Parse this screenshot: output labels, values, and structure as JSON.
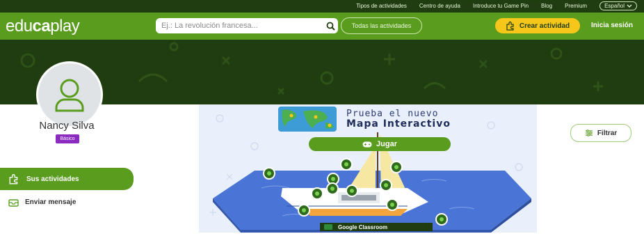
{
  "top_links": [
    "Tipos de actividades",
    "Centro de ayuda",
    "Introduce tu Game Pin",
    "Blog",
    "Premium"
  ],
  "language": "Español",
  "logo": {
    "part1": "edu",
    "part2": "ca",
    "part3": "play"
  },
  "search": {
    "placeholder": "Ej.: La revolución francesa..."
  },
  "all_activities_label": "Todas las actividades",
  "create_label": "Crear actividad",
  "login_label": "Inicia sesión",
  "profile": {
    "name": "Nancy Silva",
    "badge": "Básico"
  },
  "sidebar": {
    "items": [
      {
        "label": "Sus actividades",
        "active": true
      },
      {
        "label": "Enviar mensaje",
        "active": false
      }
    ]
  },
  "ad": {
    "line1": "Prueba el nuevo",
    "line2": "Mapa Interactivo",
    "play_label": "Jugar",
    "classroom_label": "Google Classroom"
  },
  "filter_label": "Filtrar",
  "colors": {
    "brand_green": "#5a9c1e",
    "dark_green": "#1f3d10",
    "yellow": "#f7c61a",
    "purple": "#8b2bbf"
  }
}
